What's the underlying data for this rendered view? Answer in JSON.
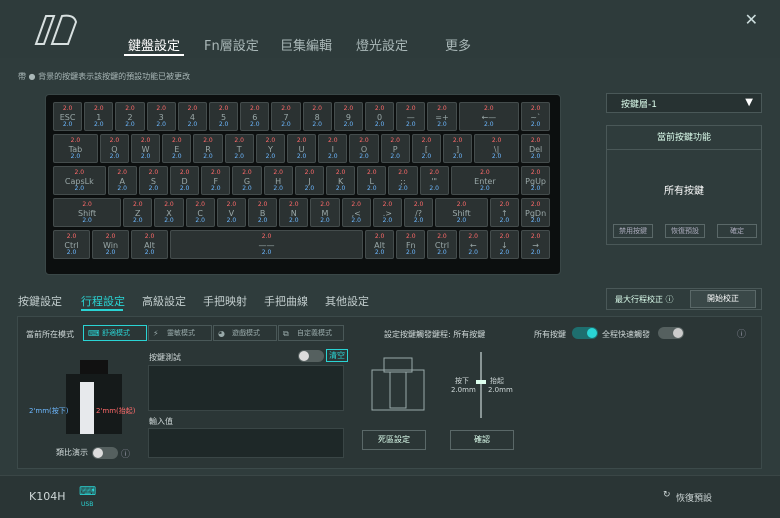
{
  "tabs": [
    "鍵盤設定",
    "Fn層設定",
    "巨集編輯",
    "燈光設定",
    "更多"
  ],
  "hint": "帶 ● 背景的按鍵表示該按鍵的預設功能已被更改",
  "keys": [
    {
      "l": "ESC",
      "n": "2.0",
      "b": "2.0"
    },
    {
      "l": "1",
      "n": "2.0",
      "b": "2.0"
    },
    {
      "l": "2",
      "n": "2.0",
      "b": "2.0"
    },
    {
      "l": "3",
      "n": "2.0",
      "b": "2.0"
    },
    {
      "l": "4",
      "n": "2.0",
      "b": "2.0"
    },
    {
      "l": "5",
      "n": "2.0",
      "b": "2.0"
    },
    {
      "l": "6",
      "n": "2.0",
      "b": "2.0"
    },
    {
      "l": "7",
      "n": "2.0",
      "b": "2.0"
    },
    {
      "l": "8",
      "n": "2.0",
      "b": "2.0"
    },
    {
      "l": "9",
      "n": "2.0",
      "b": "2.0"
    },
    {
      "l": "0",
      "n": "2.0",
      "b": "2.0"
    },
    {
      "l": "—",
      "n": "2.0",
      "b": "2.0"
    },
    {
      "l": "=+",
      "n": "2.0",
      "b": "2.0"
    },
    {
      "l": "←—",
      "n": "2.0",
      "b": "2.0"
    },
    {
      "l": "~`",
      "n": "2.0",
      "b": "2.0"
    },
    {
      "l": "Tab",
      "n": "2.0",
      "b": "2.0"
    },
    {
      "l": "Q",
      "n": "2.0",
      "b": "2.0"
    },
    {
      "l": "W",
      "n": "2.0",
      "b": "2.0"
    },
    {
      "l": "E",
      "n": "2.0",
      "b": "2.0"
    },
    {
      "l": "R",
      "n": "2.0",
      "b": "2.0"
    },
    {
      "l": "T",
      "n": "2.0",
      "b": "2.0"
    },
    {
      "l": "Y",
      "n": "2.0",
      "b": "2.0"
    },
    {
      "l": "U",
      "n": "2.0",
      "b": "2.0"
    },
    {
      "l": "I",
      "n": "2.0",
      "b": "2.0"
    },
    {
      "l": "O",
      "n": "2.0",
      "b": "2.0"
    },
    {
      "l": "P",
      "n": "2.0",
      "b": "2.0"
    },
    {
      "l": "[",
      "n": "2.0",
      "b": "2.0"
    },
    {
      "l": "]",
      "n": "2.0",
      "b": "2.0"
    },
    {
      "l": "\\|",
      "n": "2.0",
      "b": "2.0"
    },
    {
      "l": "Del",
      "n": "2.0",
      "b": "2.0"
    },
    {
      "l": "CapsLk",
      "n": "2.0",
      "b": "2.0"
    },
    {
      "l": "A",
      "n": "2.0",
      "b": "2.0"
    },
    {
      "l": "S",
      "n": "2.0",
      "b": "2.0"
    },
    {
      "l": "D",
      "n": "2.0",
      "b": "2.0"
    },
    {
      "l": "F",
      "n": "2.0",
      "b": "2.0"
    },
    {
      "l": "G",
      "n": "2.0",
      "b": "2.0"
    },
    {
      "l": "H",
      "n": "2.0",
      "b": "2.0"
    },
    {
      "l": "J",
      "n": "2.0",
      "b": "2.0"
    },
    {
      "l": "K",
      "n": "2.0",
      "b": "2.0"
    },
    {
      "l": "L",
      "n": "2.0",
      "b": "2.0"
    },
    {
      "l": ";:",
      "n": "2.0",
      "b": "2.0"
    },
    {
      "l": "'\"",
      "n": "2.0",
      "b": "2.0"
    },
    {
      "l": "Enter",
      "n": "2.0",
      "b": "2.0"
    },
    {
      "l": "PgUp",
      "n": "2.0",
      "b": "2.0"
    },
    {
      "l": "Shift",
      "n": "2.0",
      "b": "2.0"
    },
    {
      "l": "Z",
      "n": "2.0",
      "b": "2.0"
    },
    {
      "l": "X",
      "n": "2.0",
      "b": "2.0"
    },
    {
      "l": "C",
      "n": "2.0",
      "b": "2.0"
    },
    {
      "l": "V",
      "n": "2.0",
      "b": "2.0"
    },
    {
      "l": "B",
      "n": "2.0",
      "b": "2.0"
    },
    {
      "l": "N",
      "n": "2.0",
      "b": "2.0"
    },
    {
      "l": "M",
      "n": "2.0",
      "b": "2.0"
    },
    {
      "l": ",<",
      "n": "2.0",
      "b": "2.0"
    },
    {
      "l": ".>",
      "n": "2.0",
      "b": "2.0"
    },
    {
      "l": "/?",
      "n": "2.0",
      "b": "2.0"
    },
    {
      "l": "Shift",
      "n": "2.0",
      "b": "2.0"
    },
    {
      "l": "↑",
      "n": "2.0",
      "b": "2.0"
    },
    {
      "l": "PgDn",
      "n": "2.0",
      "b": "2.0"
    },
    {
      "l": "Ctrl",
      "n": "2.0",
      "b": "2.0"
    },
    {
      "l": "Win",
      "n": "2.0",
      "b": "2.0"
    },
    {
      "l": "Alt",
      "n": "2.0",
      "b": "2.0"
    },
    {
      "l": "——",
      "n": "2.0",
      "b": "2.0"
    },
    {
      "l": "Alt",
      "n": "2.0",
      "b": "2.0"
    },
    {
      "l": "Fn",
      "n": "2.0",
      "b": "2.0"
    },
    {
      "l": "Ctrl",
      "n": "2.0",
      "b": "2.0"
    },
    {
      "l": "←",
      "n": "2.0",
      "b": "2.0"
    },
    {
      "l": "↓",
      "n": "2.0",
      "b": "2.0"
    },
    {
      "l": "→",
      "n": "2.0",
      "b": "2.0"
    }
  ],
  "layer": "按鍵層-1",
  "func_title": "當前按鍵功能",
  "func_value": "所有按鍵",
  "func_buttons": [
    "禁用按鍵",
    "恢復預設",
    "確定"
  ],
  "subtabs": [
    "按鍵設定",
    "行程設定",
    "高級設定",
    "手把映射",
    "手把曲線",
    "其他設定"
  ],
  "max_travel": "最大行程校正",
  "start_calib": "開始校正",
  "mode_label": "當前所在模式",
  "modes": [
    "舒適模式",
    "靈敏模式",
    "遊戲模式",
    "自定義模式"
  ],
  "key_test": "按鍵測試",
  "clear": "清空",
  "input_value": "輸入值",
  "press": "2'mm(按下)",
  "lift": "2'mm(抬起)",
  "demo": "類比演示",
  "trigger_label": "設定按鍵觸發鍵程: 所有按鍵",
  "all_keys": "所有按鍵",
  "rapid": "全程快速觸發",
  "press_s": "按下",
  "press_v": "2.0mm",
  "lift_s": "抬起",
  "lift_v": "2.0mm",
  "deadzone": "死區設定",
  "confirm": "確認",
  "device": "K104H",
  "usb": "USB",
  "restore": "恢復預設"
}
